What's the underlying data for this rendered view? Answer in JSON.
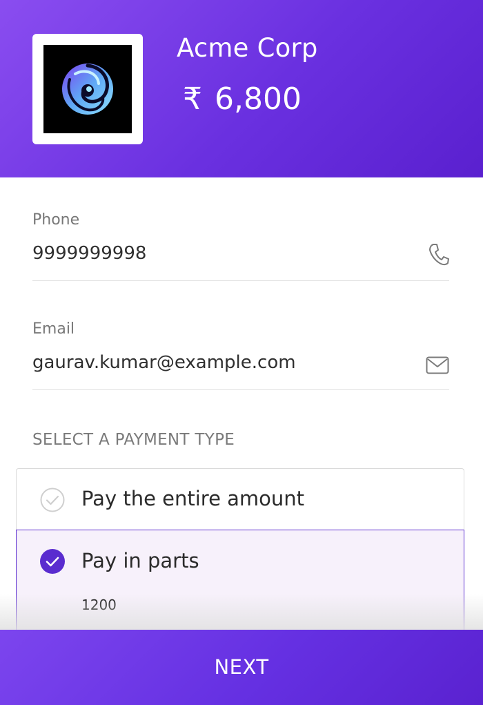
{
  "header": {
    "merchant_name": "Acme Corp",
    "currency_symbol": "₹",
    "amount": "6,800",
    "logo": "swirl-logo"
  },
  "form": {
    "phone": {
      "label": "Phone",
      "value": "9999999998",
      "icon": "phone-icon"
    },
    "email": {
      "label": "Email",
      "value": "gaurav.kumar@example.com",
      "icon": "mail-icon"
    }
  },
  "payment_type": {
    "title": "SELECT A PAYMENT TYPE",
    "options": [
      {
        "label": "Pay the entire amount",
        "selected": false
      },
      {
        "label": "Pay in parts",
        "selected": true,
        "amount": "1200"
      }
    ]
  },
  "footer": {
    "next_label": "NEXT"
  },
  "colors": {
    "brand": "#6a30e0",
    "selected_check": "#5a2ccf",
    "selected_bg": "#f7f1fb"
  }
}
